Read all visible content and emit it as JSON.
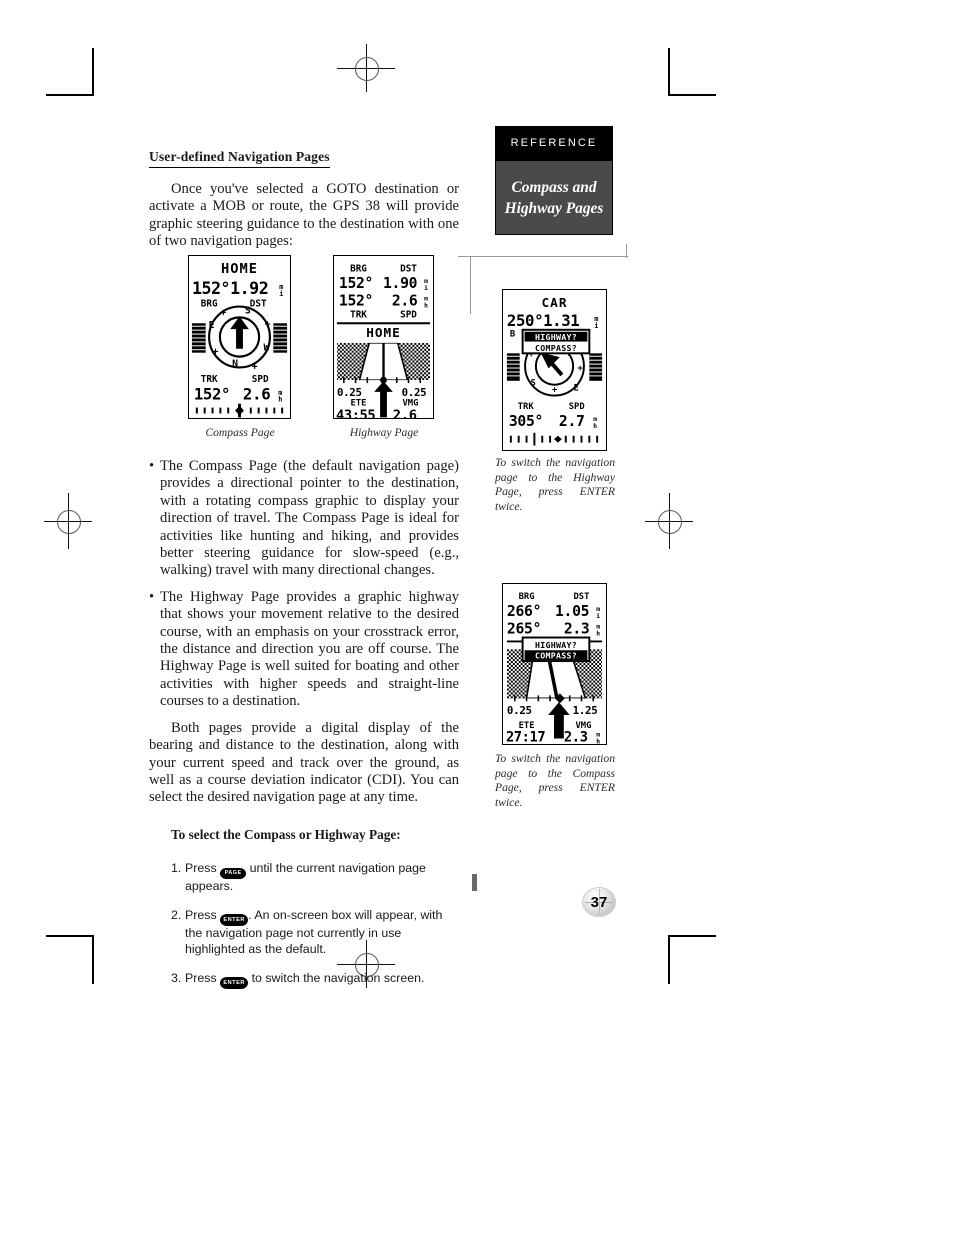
{
  "document": {
    "page_number": "37",
    "section_label": "REFERENCE",
    "topic_title_line1": "Compass and",
    "topic_title_line2": "Highway Pages"
  },
  "main": {
    "heading": "User-defined Navigation Pages",
    "intro": "Once you've selected a GOTO destination or activate a MOB or route, the GPS 38 will provide graphic steering guidance to the destination with one of two navigation pages:",
    "bullets": [
      "The Compass Page (the default navigation page) provides a directional pointer to the destination, with a rotating compass graphic to display your direction of travel. The Compass Page is ideal for activities like hunting and hiking, and provides better steering guidance for slow-speed (e.g., walking) travel with many directional changes.",
      "The Highway Page provides a graphic highway that shows your movement relative to the desired course, with an emphasis on your crosstrack error, the distance and direction you are off course. The Highway Page is well suited for boating and other activities with higher speeds and straight-line courses to a destination."
    ],
    "closing": "Both pages provide a digital display of the bearing and distance to the destination, along with your current speed and track over the ground, as well as a course deviation indicator (CDI). You can select the desired navigation page at any time.",
    "procedure_heading": "To select the Compass or Highway Page:",
    "steps": [
      {
        "number": "1.",
        "press_label": "Press",
        "key": "PAGE",
        "text": " until the current navigation page appears."
      },
      {
        "number": "2.",
        "press_label": "Press",
        "key": "ENTER",
        "text": ". An on-screen box will appear, with the navigation page not currently in use highlighted as the default."
      },
      {
        "number": "3.",
        "press_label": "Press",
        "key": "ENTER",
        "text": " to switch the navigation screen."
      }
    ]
  },
  "figures": {
    "compass_page": {
      "caption": "Compass Page",
      "destination": "HOME",
      "bearing_value": "152°",
      "distance_value": "1.92",
      "distance_unit": "ᵐᵢ",
      "bearing_label": "BRG",
      "distance_label": "DST",
      "track_label": "TRK",
      "speed_label": "SPD",
      "track_value": "152°",
      "speed_value": "2.6",
      "speed_unit": "ᵐₕ",
      "compass_marks": [
        "E",
        "N",
        "W",
        "S"
      ]
    },
    "highway_page": {
      "caption": "Highway Page",
      "bearing_label": "BRG",
      "distance_label": "DST",
      "bearing_value": "152°",
      "distance_value": "1.90",
      "track_value": "152°",
      "speed_value": "2.6",
      "track_label": "TRK",
      "speed_label": "SPD",
      "destination": "HOME",
      "cdi_left": "0.25",
      "cdi_right": "0.25",
      "ete_label": "ETE",
      "vmg_label": "VMG",
      "ete_value": "43:55",
      "vmg_value": "2.6"
    },
    "sidebar_compass": {
      "destination": "CAR",
      "bearing_value": "250°",
      "distance_value": "1.31",
      "option_highway": "HIGHWAY?",
      "option_compass": "COMPASS?",
      "selected_option": "HIGHWAY?",
      "track_label": "TRK",
      "speed_label": "SPD",
      "track_value": "305°",
      "speed_value": "2.7",
      "caption": "To switch the navigation page to the Highway Page, press ENTER twice."
    },
    "sidebar_highway": {
      "bearing_label": "BRG",
      "distance_label": "DST",
      "bearing_value": "266°",
      "distance_value": "1.05",
      "track_value": "265°",
      "speed_value": "2.3",
      "option_highway": "HIGHWAY?",
      "option_compass": "COMPASS?",
      "selected_option": "COMPASS?",
      "cdi_left": "0.25",
      "cdi_right": "1.25",
      "ete_label": "ETE",
      "vmg_label": "VMG",
      "ete_value": "27:17",
      "vmg_value": "2.3",
      "caption": "To switch the navigation page to the Compass Page, press ENTER twice."
    }
  },
  "colors": {
    "reference_tab_bg": "#000000",
    "topic_tab_bg": "#4a4a4a",
    "rule": "#999999",
    "text": "#1a1a1a"
  }
}
